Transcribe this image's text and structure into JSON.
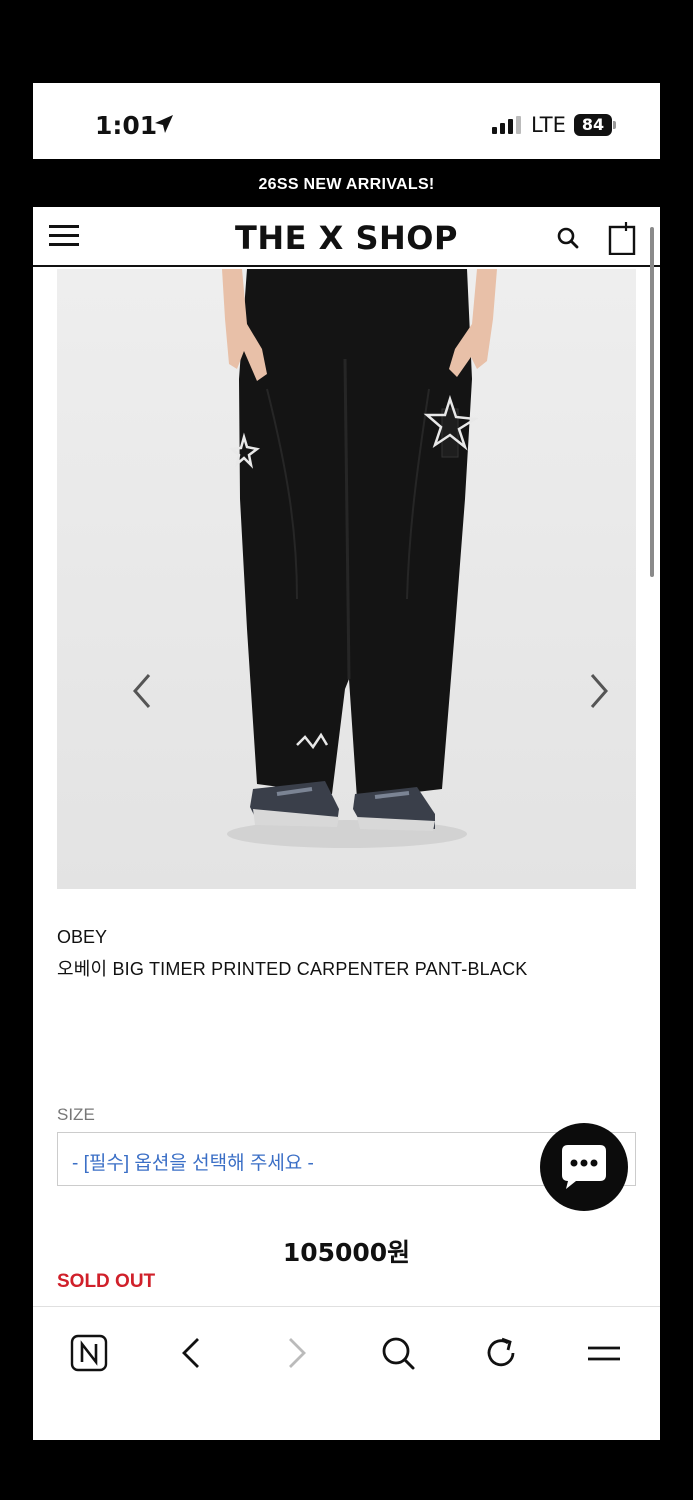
{
  "status_bar": {
    "time": "1:01",
    "network": "LTE",
    "battery": "84"
  },
  "announcement": "26SS NEW ARRIVALS!",
  "header": {
    "title": "THE X SHOP"
  },
  "product": {
    "brand": "OBEY",
    "title": "오베이 BIG TIMER PRINTED CARPENTER PANT-BLACK",
    "size_label": "SIZE",
    "size_placeholder": "- [필수] 옵션을 선택해 주세요 -",
    "price": "105000원",
    "status": "SOLD OUT"
  },
  "colors": {
    "accent_link": "#3b6fc6",
    "sold_out": "#d0202a",
    "background": "#ffffff",
    "announcement_bg": "#000000"
  },
  "icons": {
    "menu": "hamburger-icon",
    "search": "search-icon",
    "cart": "shopping-bag-icon",
    "chat": "chat-bubble-icon",
    "browser": [
      "naver-home-icon",
      "back-icon",
      "forward-icon",
      "search-icon",
      "reload-icon",
      "menu-icon"
    ]
  }
}
